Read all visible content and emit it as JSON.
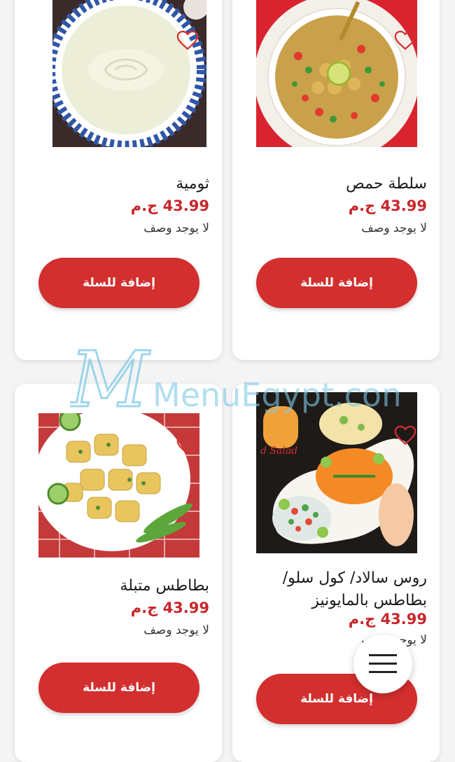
{
  "currency_label": "ج.م",
  "add_to_cart_label": "إضافة للسلة",
  "no_description_label": "لا يوجد وصف",
  "watermark_text": "MenuEgypt.com",
  "products": [
    {
      "name": "سلطة حمص",
      "price": "43.99 ج.م",
      "description": "لا يوجد وصف",
      "image": "chickpea-salad"
    },
    {
      "name": "ثومية",
      "price": "43.99 ج.م",
      "description": "لا يوجد وصف",
      "image": "garlic-dip"
    },
    {
      "name": "روس سالاد/ كول سلو/ بطاطس بالمايونيز",
      "price": "43.99 ج.م",
      "description": "لا يوجد وصف",
      "image": "mixed-salads"
    },
    {
      "name": "بطاطس متبلة",
      "price": "43.99 ج.م",
      "description": "لا يوجد وصف",
      "image": "spiced-potatoes"
    }
  ],
  "colors": {
    "accent": "#d32f2f",
    "price": "#c8262a",
    "background": "#f4f4f4"
  },
  "icons": {
    "favorite": "heart-outline-icon",
    "menu": "hamburger-menu-icon"
  }
}
